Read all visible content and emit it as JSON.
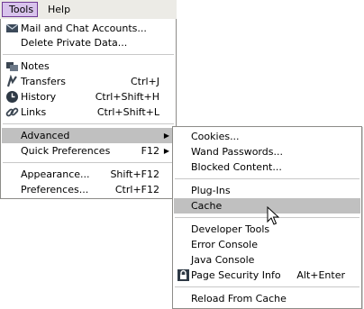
{
  "menubar": {
    "tools_label": "Tools",
    "help_label": "Help"
  },
  "tools_menu": {
    "mail_label": "Mail and Chat Accounts...",
    "delete_private_label": "Delete Private Data...",
    "notes_label": "Notes",
    "transfers_label": "Transfers",
    "transfers_shortcut": "Ctrl+J",
    "history_label": "History",
    "history_shortcut": "Ctrl+Shift+H",
    "links_label": "Links",
    "links_shortcut": "Ctrl+Shift+L",
    "advanced_label": "Advanced",
    "quick_prefs_label": "Quick Preferences",
    "quick_prefs_shortcut": "F12",
    "appearance_label": "Appearance...",
    "appearance_shortcut": "Shift+F12",
    "preferences_label": "Preferences...",
    "preferences_shortcut": "Ctrl+F12"
  },
  "advanced_menu": {
    "cookies_label": "Cookies...",
    "wand_label": "Wand Passwords...",
    "blocked_label": "Blocked Content...",
    "plugins_label": "Plug-Ins",
    "cache_label": "Cache",
    "devtools_label": "Developer Tools",
    "error_console_label": "Error Console",
    "java_console_label": "Java Console",
    "page_security_label": "Page Security Info",
    "page_security_shortcut": "Alt+Enter",
    "reload_cache_label": "Reload From Cache"
  },
  "icons": {
    "mail": "mail-icon",
    "notes": "notes-icon",
    "transfers": "transfers-icon",
    "history": "history-icon",
    "links": "links-icon",
    "security": "security-icon"
  },
  "colors": {
    "menubar_bg": "#ecebe6",
    "tools_active_bg": "#d8c3ec",
    "highlight": "#c0c0c0"
  }
}
